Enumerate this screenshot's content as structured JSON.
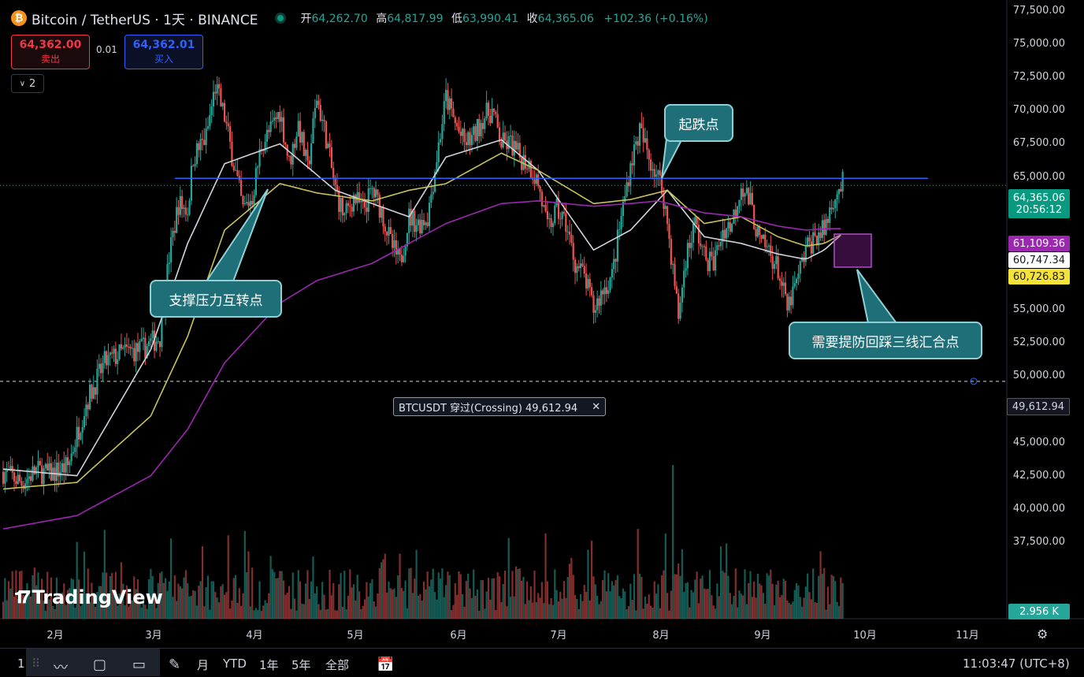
{
  "header": {
    "coin_icon": "bitcoin-icon",
    "symbol": "Bitcoin / TetherUS · 1天 · BINANCE",
    "ohlc": [
      {
        "k": "开",
        "v": "64,262.70"
      },
      {
        "k": "高",
        "v": "64,817.99"
      },
      {
        "k": "低",
        "v": "63,990.41"
      },
      {
        "k": "收",
        "v": "64,365.06"
      }
    ],
    "change": "+102.36 (+0.16%)"
  },
  "trade": {
    "sell_price": "64,362.00",
    "sell_label": "卖出",
    "spread": "0.01",
    "buy_price": "64,362.01",
    "buy_label": "买入",
    "collapse_count": "2"
  },
  "price_labels": {
    "last_price": "64,365.06",
    "countdown": "20:56:12",
    "ma_purple": "61,109.36",
    "ma_white": "60,747.34",
    "ma_yellow": "60,726.83",
    "alert": "49,612.94",
    "volume": "2.956 K"
  },
  "alert": {
    "text": "BTCUSDT 穿过(Crossing) 49,612.94",
    "close": "✕"
  },
  "callouts": {
    "support": "支撑压力互转点",
    "drop": "起跌点",
    "warn": "需要提防回踩三线汇合点"
  },
  "watermark": "TradingView",
  "toolbar": {
    "left_num": "1",
    "ranges": [
      "月",
      "YTD",
      "1年",
      "5年",
      "全部"
    ],
    "clock": "11:03:47 (UTC+8)"
  },
  "colors": {
    "up": "#26a69a",
    "down": "#ef5350",
    "ma_white": "#d1d4dc",
    "ma_yellow": "#c8c25a",
    "ma_purple": "#9c27b0",
    "hline": "#2962ff"
  },
  "chart_data": {
    "type": "candlestick",
    "title": "",
    "y_ticks": [
      "77,500.00",
      "75,000.00",
      "72,500.00",
      "70,000.00",
      "67,500.00",
      "65,000.00",
      "62,500.00",
      "60,000.00",
      "57,500.00",
      "55,000.00",
      "52,500.00",
      "50,000.00",
      "47,500.00",
      "45,000.00",
      "42,500.00",
      "40,000.00",
      "37,500.00"
    ],
    "x_ticks": [
      "2月",
      "3月",
      "4月",
      "5月",
      "6月",
      "7月",
      "8月",
      "9月",
      "10月",
      "11月"
    ],
    "ylim": [
      35000,
      78000
    ],
    "close_path": [
      [
        0,
        42800
      ],
      [
        10,
        42000
      ],
      [
        18,
        42900
      ],
      [
        25,
        42600
      ],
      [
        35,
        43200
      ],
      [
        45,
        48000
      ],
      [
        55,
        51000
      ],
      [
        65,
        51800
      ],
      [
        75,
        52000
      ],
      [
        85,
        53000
      ],
      [
        90,
        59000
      ],
      [
        95,
        63000
      ],
      [
        100,
        62500
      ],
      [
        103,
        66500
      ],
      [
        110,
        68000
      ],
      [
        115,
        71800
      ],
      [
        120,
        69500
      ],
      [
        125,
        66000
      ],
      [
        130,
        62500
      ],
      [
        135,
        63500
      ],
      [
        140,
        67500
      ],
      [
        145,
        68500
      ],
      [
        150,
        70000
      ],
      [
        155,
        66000
      ],
      [
        160,
        69000
      ],
      [
        165,
        65500
      ],
      [
        170,
        71000
      ],
      [
        175,
        68000
      ],
      [
        180,
        64000
      ],
      [
        185,
        62000
      ],
      [
        190,
        63500
      ],
      [
        195,
        62500
      ],
      [
        200,
        64000
      ],
      [
        205,
        62500
      ],
      [
        210,
        60000
      ],
      [
        215,
        58500
      ],
      [
        220,
        62000
      ],
      [
        225,
        61500
      ],
      [
        230,
        62000
      ],
      [
        235,
        66500
      ],
      [
        240,
        71000
      ],
      [
        245,
        69000
      ],
      [
        250,
        67500
      ],
      [
        255,
        68000
      ],
      [
        260,
        69500
      ],
      [
        265,
        70000
      ],
      [
        270,
        67500
      ],
      [
        275,
        67500
      ],
      [
        280,
        66500
      ],
      [
        285,
        66000
      ],
      [
        290,
        64500
      ],
      [
        295,
        61000
      ],
      [
        300,
        62500
      ],
      [
        305,
        61500
      ],
      [
        310,
        58500
      ],
      [
        315,
        57500
      ],
      [
        320,
        55000
      ],
      [
        325,
        56500
      ],
      [
        330,
        57500
      ],
      [
        335,
        62000
      ],
      [
        340,
        66000
      ],
      [
        345,
        68500
      ],
      [
        350,
        66500
      ],
      [
        355,
        65000
      ],
      [
        358,
        63500
      ],
      [
        360,
        61500
      ],
      [
        363,
        58000
      ],
      [
        366,
        54500
      ],
      [
        370,
        59000
      ],
      [
        375,
        61500
      ],
      [
        380,
        59000
      ],
      [
        385,
        58500
      ],
      [
        390,
        61000
      ],
      [
        395,
        61500
      ],
      [
        400,
        64500
      ],
      [
        405,
        63000
      ],
      [
        410,
        60000
      ],
      [
        415,
        59500
      ],
      [
        420,
        58000
      ],
      [
        425,
        55000
      ],
      [
        430,
        57000
      ],
      [
        435,
        59500
      ],
      [
        440,
        60500
      ],
      [
        445,
        61000
      ],
      [
        450,
        63500
      ],
      [
        455,
        64500
      ]
    ],
    "series": [
      {
        "name": "",
        "values_path": [
          [
            0,
            43000
          ],
          [
            40,
            42500
          ],
          [
            80,
            52000
          ],
          [
            100,
            60000
          ],
          [
            120,
            66000
          ],
          [
            150,
            67500
          ],
          [
            180,
            64000
          ],
          [
            200,
            63000
          ],
          [
            220,
            62000
          ],
          [
            240,
            66500
          ],
          [
            270,
            67800
          ],
          [
            290,
            65500
          ],
          [
            320,
            59500
          ],
          [
            340,
            61000
          ],
          [
            360,
            64000
          ],
          [
            380,
            60500
          ],
          [
            400,
            60000
          ],
          [
            420,
            59200
          ],
          [
            435,
            58800
          ],
          [
            445,
            59500
          ],
          [
            455,
            60747
          ]
        ]
      },
      {
        "name": "",
        "values_path": [
          [
            0,
            41500
          ],
          [
            40,
            42000
          ],
          [
            80,
            47000
          ],
          [
            100,
            53000
          ],
          [
            120,
            61000
          ],
          [
            150,
            64500
          ],
          [
            170,
            63800
          ],
          [
            200,
            63200
          ],
          [
            220,
            64000
          ],
          [
            240,
            64500
          ],
          [
            270,
            66800
          ],
          [
            290,
            65500
          ],
          [
            320,
            63000
          ],
          [
            340,
            63300
          ],
          [
            360,
            64000
          ],
          [
            380,
            61500
          ],
          [
            400,
            62000
          ],
          [
            420,
            60500
          ],
          [
            435,
            59800
          ],
          [
            445,
            60000
          ],
          [
            455,
            60726
          ]
        ]
      },
      {
        "name": "",
        "values_path": [
          [
            0,
            38500
          ],
          [
            40,
            39500
          ],
          [
            80,
            42500
          ],
          [
            100,
            46000
          ],
          [
            120,
            51000
          ],
          [
            150,
            55500
          ],
          [
            170,
            57200
          ],
          [
            200,
            58500
          ],
          [
            220,
            60000
          ],
          [
            240,
            61500
          ],
          [
            270,
            63000
          ],
          [
            290,
            63200
          ],
          [
            320,
            62800
          ],
          [
            340,
            63000
          ],
          [
            355,
            63200
          ],
          [
            380,
            62300
          ],
          [
            400,
            62000
          ],
          [
            420,
            61300
          ],
          [
            435,
            61000
          ],
          [
            445,
            61100
          ],
          [
            455,
            61109
          ]
        ]
      }
    ],
    "horizontal_line": 64900,
    "alert_level": 49612.94,
    "legend": "none",
    "grid": false,
    "volume_max_k": 15
  }
}
